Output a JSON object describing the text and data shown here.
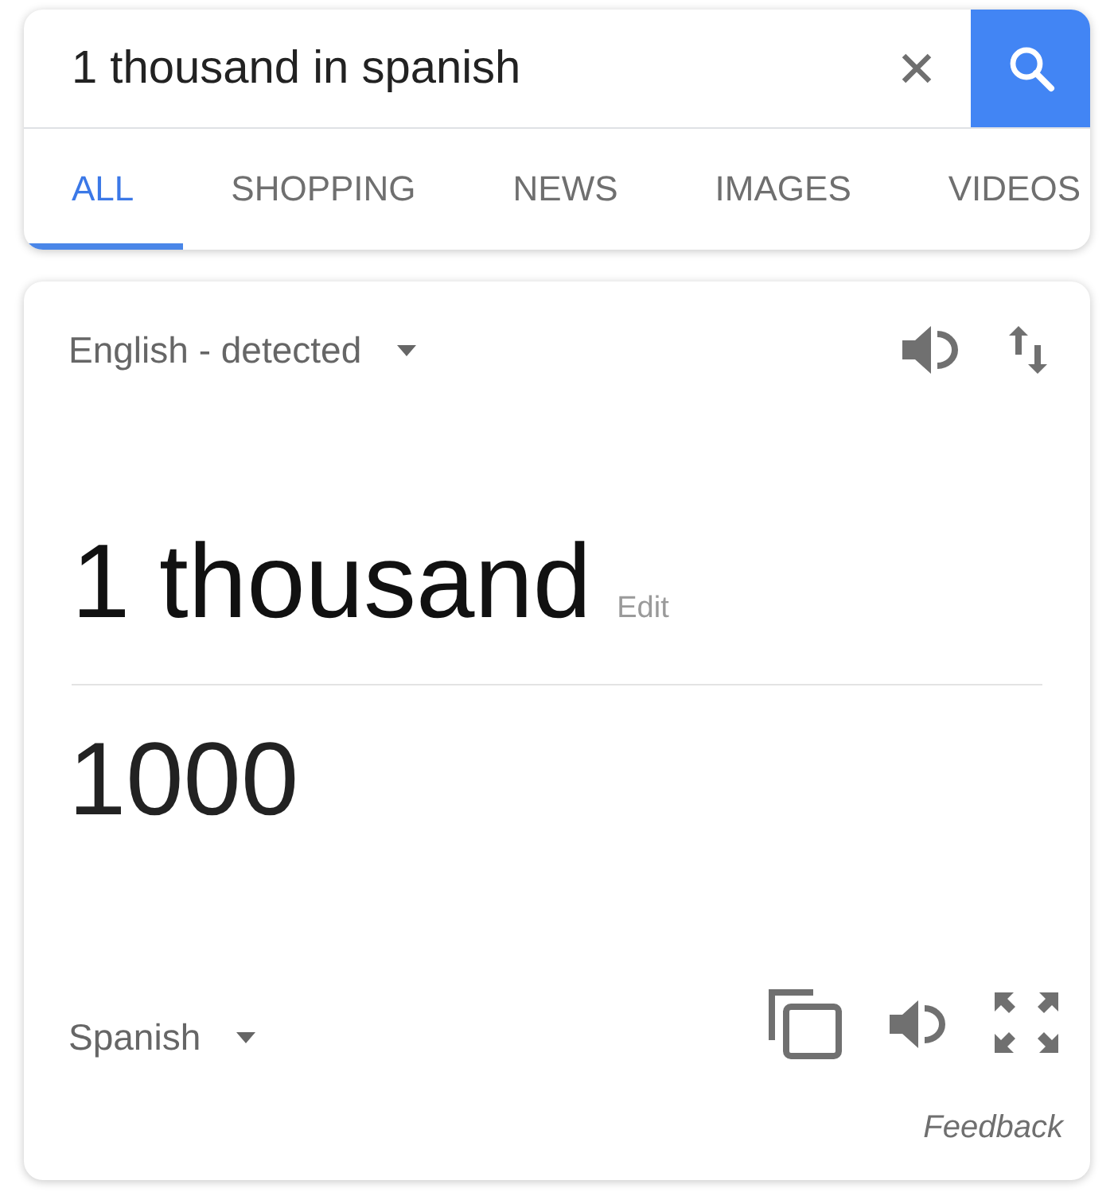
{
  "search": {
    "value": "1 thousand in spanish"
  },
  "tabs": [
    {
      "label": "ALL",
      "selected": true
    },
    {
      "label": "SHOPPING",
      "selected": false
    },
    {
      "label": "NEWS",
      "selected": false
    },
    {
      "label": "IMAGES",
      "selected": false
    },
    {
      "label": "VIDEOS",
      "selected": false
    }
  ],
  "translator": {
    "source_language": "English - detected",
    "source_text": "1 thousand",
    "edit_link": "Edit",
    "result": "1000",
    "target_language": "Spanish",
    "feedback": "Feedback"
  }
}
